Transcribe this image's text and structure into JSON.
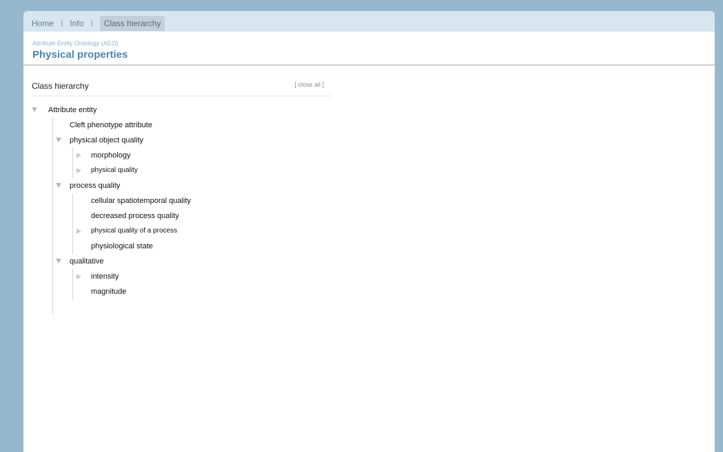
{
  "nav": {
    "home": "Home",
    "info": "Info",
    "class_hierarchy": "Class hierarchy",
    "separator": "I"
  },
  "header": {
    "subtitle": "Attribute Entity Ontology (AEO)",
    "title": "Physical properties"
  },
  "panel": {
    "title": "Class hierarchy",
    "close_all": "[ close all ]"
  },
  "tree": {
    "root": "Attribute entity",
    "cleft": "Cleft phenotype attribute",
    "physical_object_quality": "physical object quality",
    "morphology": "morphology",
    "physical_quality": "physical quality",
    "process_quality": "process quality",
    "cellular": "cellular spatiotemporal quality",
    "decreased": "decreased process quality",
    "physical_quality_process": "physical quality of a process",
    "physiological": "physiological state",
    "qualitative": "qualitative",
    "intensity": "intensity",
    "magnitude": "magnitude"
  },
  "colors": {
    "background": "#97b7cc",
    "topbar": "#d7e6ef",
    "title": "#4a86b3",
    "subtitle": "#8fb2ca"
  }
}
